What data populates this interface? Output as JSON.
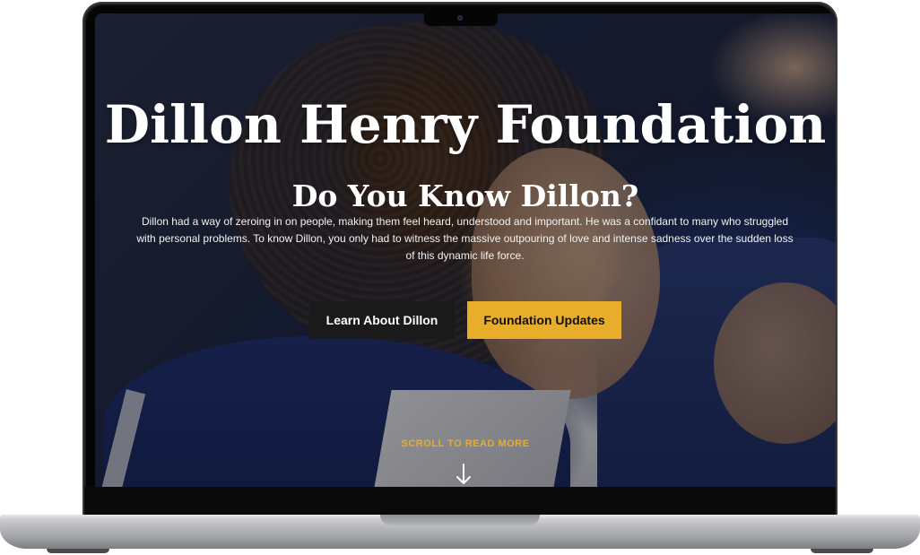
{
  "hero": {
    "title": "Dillon Henry Foundation",
    "heading": "Do You Know Dillon?",
    "paragraph": "Dillon had a way of zeroing in on people, making them feel heard, understood and important. He was a confidant to many who struggled with personal problems. To know Dillon, you only had to witness the massive outpouring of love and intense sadness over the sudden loss of this dynamic life force."
  },
  "buttons": {
    "learn_label": "Learn About Dillon",
    "updates_label": "Foundation Updates"
  },
  "scroll": {
    "label": "SCROLL TO READ MORE",
    "icon": "arrow-down-icon"
  },
  "colors": {
    "accent": "#e8ad2a",
    "dark_button": "#1a1a1a",
    "text": "#ffffff"
  }
}
